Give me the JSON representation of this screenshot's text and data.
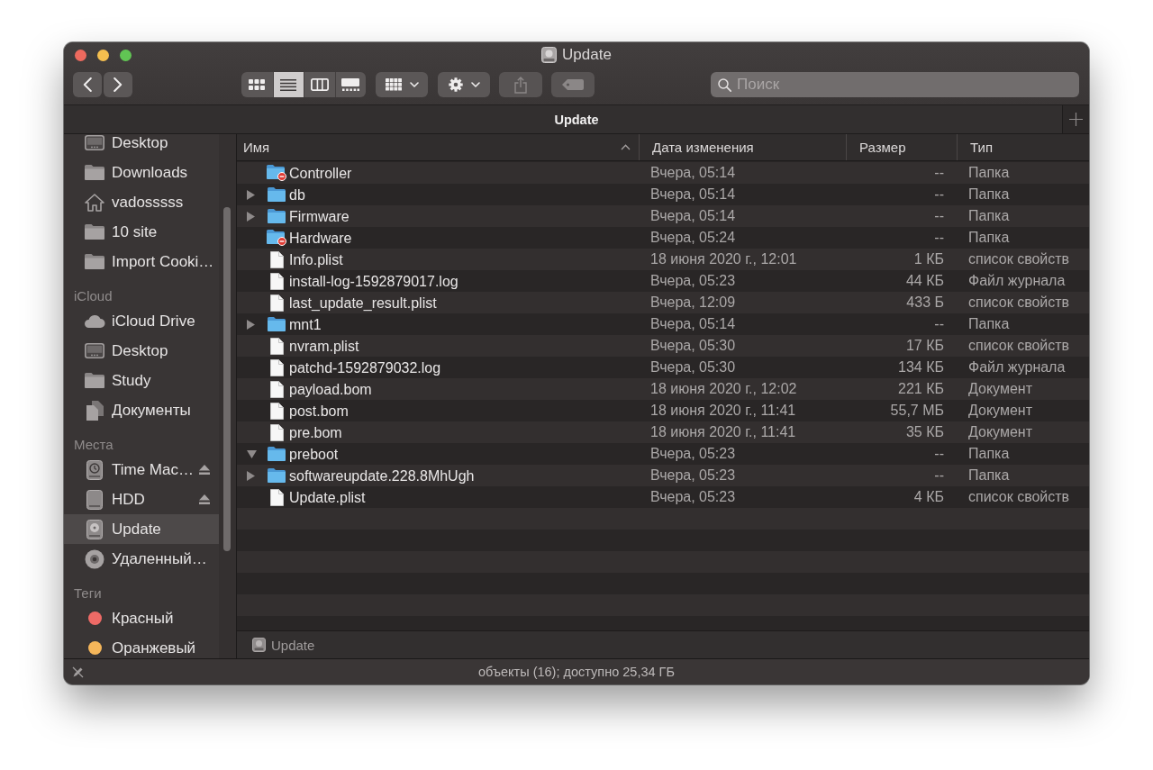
{
  "window": {
    "title": "Update"
  },
  "toolbar": {
    "view_modes": [
      {
        "kind": "icons",
        "selected": false
      },
      {
        "kind": "list",
        "selected": true
      },
      {
        "kind": "columns",
        "selected": false
      },
      {
        "kind": "gallery",
        "selected": false
      }
    ],
    "buttons": [
      {
        "kind": "group",
        "disabled": false
      },
      {
        "kind": "action",
        "disabled": false
      },
      {
        "kind": "share",
        "disabled": true
      },
      {
        "kind": "tags",
        "disabled": true
      }
    ],
    "search": {
      "placeholder": "Поиск"
    }
  },
  "tab_bar": {
    "title": "Update"
  },
  "sidebar": {
    "sections": [
      {
        "items": [
          {
            "label": "Desktop",
            "kind": "desktop",
            "selected": false
          },
          {
            "label": "Downloads",
            "kind": "folder",
            "selected": false
          },
          {
            "label": "vadosssss",
            "kind": "home",
            "selected": false
          },
          {
            "label": "10 site",
            "kind": "folder",
            "selected": false
          },
          {
            "label": "Import Cooki…",
            "kind": "folder",
            "selected": false
          }
        ]
      },
      {
        "title": "iCloud",
        "items": [
          {
            "label": "iCloud Drive",
            "kind": "cloud",
            "selected": false
          },
          {
            "label": "Desktop",
            "kind": "desktop",
            "selected": false
          },
          {
            "label": "Study",
            "kind": "folder",
            "selected": false
          },
          {
            "label": "Документы",
            "kind": "documents",
            "selected": false
          }
        ]
      },
      {
        "title": "Места",
        "items": [
          {
            "label": "Time Mac…",
            "kind": "time_machine",
            "selected": false,
            "ejectable": true
          },
          {
            "label": "HDD",
            "kind": "drive",
            "selected": false,
            "ejectable": true
          },
          {
            "label": "Update",
            "kind": "disk_image",
            "selected": true,
            "ejectable": false
          },
          {
            "label": "Удаленный…",
            "kind": "optical",
            "selected": false,
            "ejectable": false
          }
        ]
      },
      {
        "title": "Теги",
        "items": [
          {
            "label": "Красный",
            "kind": "tag",
            "color": "#ee6a66",
            "selected": false
          },
          {
            "label": "Оранжевый",
            "kind": "tag",
            "color": "#f5b65a",
            "selected": false
          }
        ]
      }
    ]
  },
  "columns": [
    {
      "label": "Имя",
      "sorted": true
    },
    {
      "label": "Дата изменения",
      "sorted": false
    },
    {
      "label": "Размер",
      "sorted": false
    },
    {
      "label": "Тип",
      "sorted": false
    }
  ],
  "rows": [
    {
      "name": "Controller",
      "kind": "restricted_folder",
      "modified": "Вчера, 05:14",
      "size": "--",
      "type": "Папка"
    },
    {
      "name": "db",
      "kind": "folder",
      "expanded": false,
      "modified": "Вчера, 05:14",
      "size": "--",
      "type": "Папка"
    },
    {
      "name": "Firmware",
      "kind": "folder",
      "expanded": false,
      "modified": "Вчера, 05:14",
      "size": "--",
      "type": "Папка"
    },
    {
      "name": "Hardware",
      "kind": "restricted_folder",
      "modified": "Вчера, 05:24",
      "size": "--",
      "type": "Папка"
    },
    {
      "name": "Info.plist",
      "kind": "file",
      "modified": "18 июня 2020 г., 12:01",
      "size": "1 КБ",
      "type": "список свойств"
    },
    {
      "name": "install-log-1592879017.log",
      "kind": "file",
      "modified": "Вчера, 05:23",
      "size": "44 КБ",
      "type": "Файл журнала"
    },
    {
      "name": "last_update_result.plist",
      "kind": "file",
      "modified": "Вчера, 12:09",
      "size": "433 Б",
      "type": "список свойств"
    },
    {
      "name": "mnt1",
      "kind": "folder",
      "expanded": false,
      "modified": "Вчера, 05:14",
      "size": "--",
      "type": "Папка"
    },
    {
      "name": "nvram.plist",
      "kind": "file",
      "modified": "Вчера, 05:30",
      "size": "17 КБ",
      "type": "список свойств"
    },
    {
      "name": "patchd-1592879032.log",
      "kind": "file",
      "modified": "Вчера, 05:30",
      "size": "134 КБ",
      "type": "Файл журнала"
    },
    {
      "name": "payload.bom",
      "kind": "file",
      "modified": "18 июня 2020 г., 12:02",
      "size": "221 КБ",
      "type": "Документ"
    },
    {
      "name": "post.bom",
      "kind": "file",
      "modified": "18 июня 2020 г., 11:41",
      "size": "55,7 МБ",
      "type": "Документ"
    },
    {
      "name": "pre.bom",
      "kind": "file",
      "modified": "18 июня 2020 г., 11:41",
      "size": "35 КБ",
      "type": "Документ"
    },
    {
      "name": "preboot",
      "kind": "folder",
      "expanded": true,
      "modified": "Вчера, 05:23",
      "size": "--",
      "type": "Папка"
    },
    {
      "name": "softwareupdate.228.8MhUgh",
      "kind": "folder",
      "expanded": false,
      "modified": "Вчера, 05:23",
      "size": "--",
      "type": "Папка"
    },
    {
      "name": "Update.plist",
      "kind": "file",
      "modified": "Вчера, 05:23",
      "size": "4 КБ",
      "type": "список свойств"
    }
  ],
  "path_bar": {
    "label": "Update"
  },
  "status_bar": {
    "text": "объекты (16); доступно 25,34 ГБ"
  }
}
